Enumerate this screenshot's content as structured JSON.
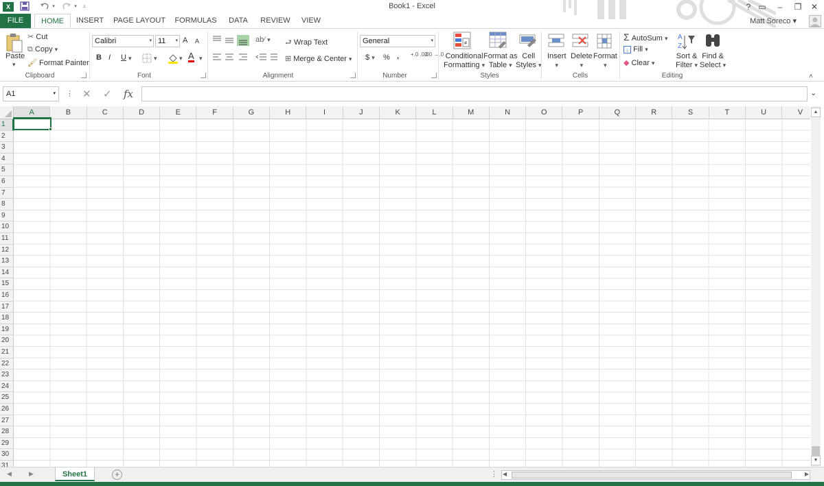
{
  "window": {
    "title": "Book1 - Excel",
    "help": "?",
    "restore": "▭",
    "minimize": "–",
    "maximize": "❐",
    "close": "✕"
  },
  "qat": {
    "app_icon": "X",
    "save": "save-icon",
    "undo": "undo-icon",
    "redo": "redo-icon"
  },
  "tabs": [
    {
      "label": "FILE"
    },
    {
      "label": "HOME"
    },
    {
      "label": "INSERT"
    },
    {
      "label": "PAGE LAYOUT"
    },
    {
      "label": "FORMULAS"
    },
    {
      "label": "DATA"
    },
    {
      "label": "REVIEW"
    },
    {
      "label": "VIEW"
    }
  ],
  "user": {
    "name": "Matt Soreco"
  },
  "ribbon": {
    "clipboard": {
      "label": "Clipboard",
      "paste": "Paste",
      "cut": "Cut",
      "copy": "Copy",
      "format_painter": "Format Painter"
    },
    "font": {
      "label": "Font",
      "family": "Calibri",
      "size": "11",
      "bold": "B",
      "italic": "I",
      "underline": "U",
      "grow": "A",
      "shrink": "A",
      "color": "A"
    },
    "alignment": {
      "label": "Alignment",
      "wrap_text": "Wrap Text",
      "merge_center": "Merge & Center"
    },
    "number": {
      "label": "Number",
      "format": "General",
      "currency": "$",
      "percent": "%",
      "comma": ",",
      "inc_decimal": "+.0 .00",
      "dec_decimal": ".00 →.0"
    },
    "styles": {
      "label": "Styles",
      "conditional_1": "Conditional",
      "conditional_2": "Formatting",
      "format_as_1": "Format as",
      "format_as_2": "Table",
      "cell_styles_1": "Cell",
      "cell_styles_2": "Styles"
    },
    "cells": {
      "label": "Cells",
      "insert": "Insert",
      "delete": "Delete",
      "format": "Format"
    },
    "editing": {
      "label": "Editing",
      "autosum": "AutoSum",
      "fill": "Fill",
      "clear": "Clear",
      "sort_1": "Sort &",
      "sort_2": "Filter",
      "find_1": "Find &",
      "find_2": "Select"
    }
  },
  "formula_bar": {
    "name_box": "A1",
    "cancel": "✕",
    "enter": "✓",
    "fx": "fx",
    "value": ""
  },
  "grid": {
    "columns": [
      "A",
      "B",
      "C",
      "D",
      "E",
      "F",
      "G",
      "H",
      "I",
      "J",
      "K",
      "L",
      "M",
      "N",
      "O",
      "P",
      "Q",
      "R",
      "S",
      "T",
      "U",
      "V"
    ],
    "rows": [
      "1",
      "2",
      "3",
      "4",
      "5",
      "6",
      "7",
      "8",
      "9",
      "10",
      "11",
      "12",
      "13",
      "14",
      "15",
      "16",
      "17",
      "18",
      "19",
      "20",
      "21",
      "22",
      "23",
      "24",
      "25",
      "26",
      "27",
      "28",
      "29",
      "30",
      "31"
    ],
    "active_cell": "A1"
  },
  "sheets": [
    {
      "name": "Sheet1"
    }
  ],
  "colors": {
    "accent": "#217346",
    "grid": "#e1e1e1",
    "header_bg": "#f3f3f3"
  }
}
